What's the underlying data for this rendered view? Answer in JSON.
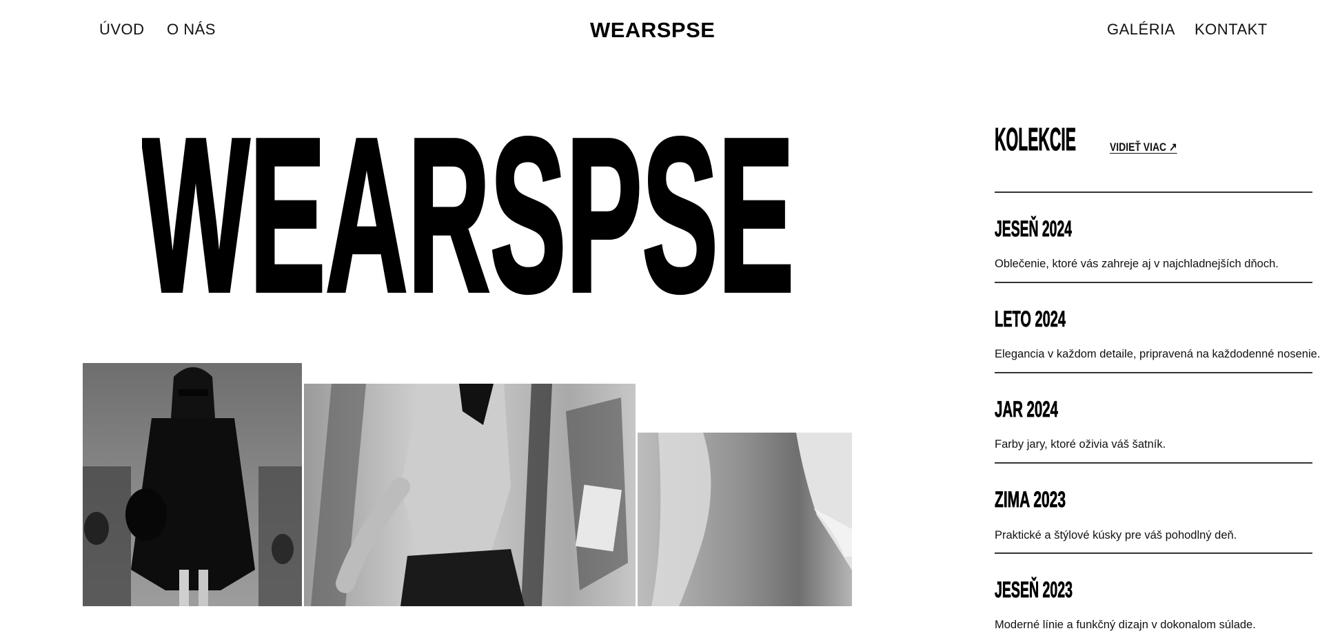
{
  "header": {
    "nav_left": [
      "ÚVOD",
      "O NÁS"
    ],
    "logo": "WEARSPSE",
    "nav_right": [
      "GALÉRIA",
      "KONTAKT"
    ]
  },
  "hero": {
    "title": "WEARSPSE"
  },
  "collections": {
    "heading": "KOLEKCIE",
    "see_more": "VIDIEŤ VIAC ↗",
    "items": [
      {
        "title": "JESEŇ 2024",
        "description": "Oblečenie, ktoré vás zahreje aj v najchladnejších dňoch."
      },
      {
        "title": "LETO 2024",
        "description": "Elegancia v každom detaile, pripravená na každodenné nosenie."
      },
      {
        "title": "JAR 2024",
        "description": "Farby jary, ktoré oživia váš šatník."
      },
      {
        "title": "ZIMA 2023",
        "description": "Praktické a štýlové kúsky pre váš pohodlný deň."
      },
      {
        "title": "JESEŇ 2023",
        "description": "Moderné línie a funkčný dizajn v dokonalom súlade."
      }
    ]
  },
  "colors": {
    "text": "#111111",
    "background": "#ffffff",
    "divider": "#333333"
  }
}
